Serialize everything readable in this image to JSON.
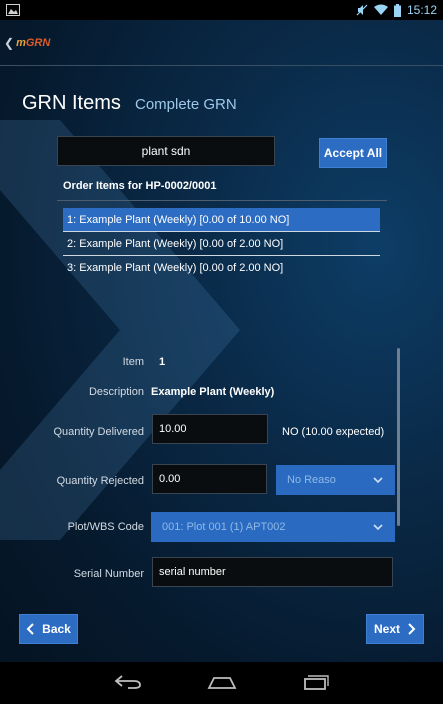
{
  "status_bar": {
    "time": "15:12"
  },
  "app": {
    "logo_m": "m",
    "logo_rest": "GRN"
  },
  "header": {
    "title": "GRN Items",
    "subtitle": "Complete GRN"
  },
  "search": {
    "value": "plant sdn"
  },
  "accept_all_label": "Accept All",
  "order": {
    "header": "Order Items for HP-0002/0001",
    "items": [
      {
        "label": "1: Example Plant (Weekly) [0.00 of 10.00 NO]",
        "selected": true
      },
      {
        "label": "2: Example Plant (Weekly) [0.00 of 2.00 NO]",
        "selected": false
      },
      {
        "label": "3: Example Plant (Weekly) [0.00 of 2.00 NO]",
        "selected": false
      }
    ]
  },
  "form": {
    "item_label": "Item",
    "item_value": "1",
    "description_label": "Description",
    "description_value": "Example Plant (Weekly)",
    "qty_delivered_label": "Quantity Delivered",
    "qty_delivered_value": "10.00",
    "expected_text": "NO (10.00 expected)",
    "qty_rejected_label": "Quantity Rejected",
    "qty_rejected_value": "0.00",
    "reason_value": "No Reaso",
    "plot_label": "Plot/WBS Code",
    "plot_value": "001: Plot 001 (1) APT002",
    "serial_label": "Serial Number",
    "serial_value": "serial number"
  },
  "footer": {
    "back_label": "Back",
    "next_label": "Next"
  },
  "colors": {
    "accent_blue": "#2c6cc2",
    "logo_orange": "#e8a23a",
    "background": "#0a2a48"
  }
}
